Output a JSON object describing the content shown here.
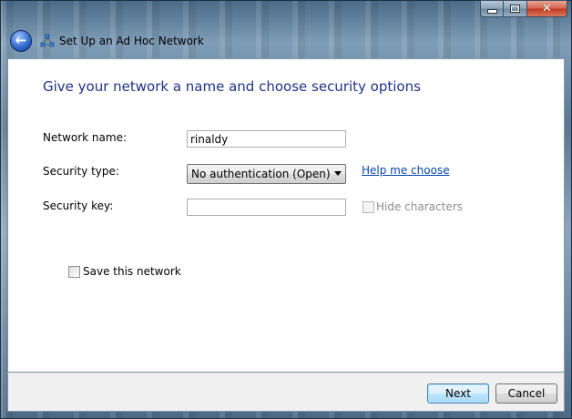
{
  "window": {
    "title": "Set Up an Ad Hoc Network",
    "icons": {
      "back": "back-arrow-icon",
      "network": "ad-hoc-network-icon",
      "minimize": "minimize-icon",
      "maximize": "maximize-icon",
      "close": "close-icon"
    }
  },
  "content": {
    "heading": "Give your network a name and choose security options",
    "network_name": {
      "label": "Network name:",
      "value": "rinaldy"
    },
    "security_type": {
      "label": "Security type:",
      "selected": "No authentication (Open)",
      "help_link": "Help me choose"
    },
    "security_key": {
      "label": "Security key:",
      "value": "",
      "hide_characters_label": "Hide characters",
      "hide_characters_checked": false
    },
    "save_network": {
      "label": "Save this network",
      "checked": false
    }
  },
  "footer": {
    "next_label": "Next",
    "cancel_label": "Cancel"
  },
  "colors": {
    "heading": "#1e3287",
    "link": "#0645ad",
    "default_button_border": "#3c7fb1"
  }
}
